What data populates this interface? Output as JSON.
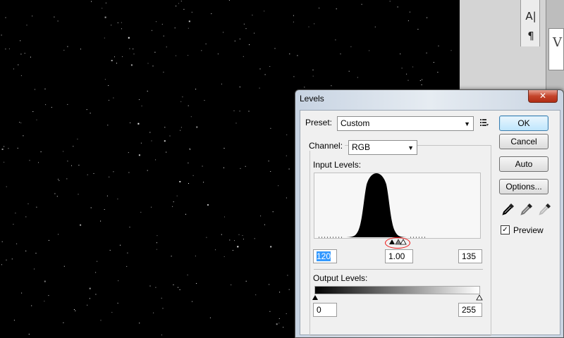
{
  "dialog": {
    "title": "Levels",
    "close_glyph": "✕",
    "preset": {
      "label": "Preset:",
      "value": "Custom",
      "menu_icon": "list-menu-icon"
    },
    "channel": {
      "label": "Channel:",
      "value": "RGB"
    },
    "input_levels": {
      "label": "Input Levels:",
      "black": "120",
      "midtone": "1.00",
      "white": "135"
    },
    "output_levels": {
      "label": "Output Levels:",
      "black": "0",
      "white": "255"
    },
    "buttons": {
      "ok": "OK",
      "cancel": "Cancel",
      "auto": "Auto",
      "options": "Options..."
    },
    "eyedroppers": [
      "black-point-eyedropper-icon",
      "gray-point-eyedropper-icon",
      "white-point-eyedropper-icon"
    ],
    "preview": {
      "label": "Preview",
      "checked": true
    }
  },
  "right_panel": {
    "tools": [
      "type-tool-icon",
      "paragraph-icon"
    ]
  },
  "canvas": {
    "content": "starfield"
  },
  "colors": {
    "dialog_frame": "#c9d4e2",
    "close_red": "#c4442b",
    "selection": "#3399ff",
    "focus_blue": "#3c7fb1",
    "marker_red": "#e11111"
  }
}
